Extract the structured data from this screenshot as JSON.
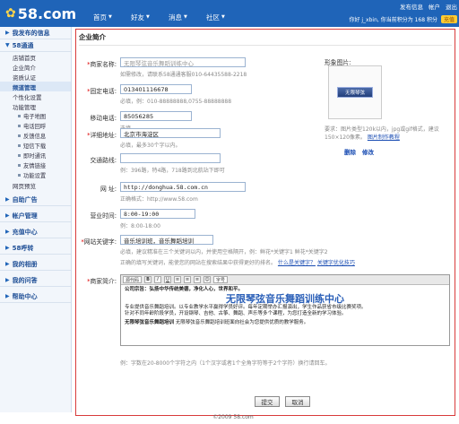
{
  "header": {
    "logo_text": "58.com",
    "nav": [
      "首页",
      "好友",
      "消息",
      "社区"
    ],
    "top_links": [
      "发布信息",
      "帐户",
      "退出"
    ],
    "user_line": "你好 j_xbin, 你当前积分为 168 积分",
    "recharge": "充值"
  },
  "sidebar": {
    "sections": [
      {
        "title": "我发布的信息"
      },
      {
        "title": "58通通",
        "items": [
          "店铺首页",
          "企业简介",
          "资质认证",
          "频道管理",
          "个性化设置",
          "功能管理"
        ]
      }
    ],
    "sub_items": [
      "电子地图",
      "电话回呼",
      "反馈信息",
      "短信下载",
      "即时通讯",
      "友情链接",
      "功能设置"
    ],
    "after_items": [
      "网页预览"
    ],
    "more_sections": [
      "自助广告",
      "帐户管理",
      "充值中心",
      "58呼转",
      "我的相册",
      "我的问答",
      "帮助中心"
    ],
    "active_item": "频道管理"
  },
  "main": {
    "title": "企业简介",
    "company_name": {
      "label": "商家名称:",
      "value": "无限琴弦音乐舞蹈训练中心",
      "hint": "如需修改，请联系58通通客服010-64435588-2218"
    },
    "fixed_phone": {
      "label": "固定电话:",
      "value": "013401116678",
      "hint": "必填，例：010-88888888,0755-88888888"
    },
    "mobile": {
      "label": "移动电话:",
      "value": "85056285",
      "hint": "选填"
    },
    "address": {
      "label": "详细地址:",
      "value": "北京市海淀区",
      "hint": "必填，最多30个字以内。"
    },
    "traffic": {
      "label": "交通路线:",
      "value": "",
      "hint": "例：396路，特4路，718路到北航站下即可"
    },
    "website": {
      "label": "网 址:",
      "value": "http://donghua.58.com.cn",
      "hint": "正确格式：http://www.58.com"
    },
    "hours": {
      "label": "营业时间:",
      "value": "8:00-19:00",
      "hint": "例：8:00-18:00"
    },
    "keywords": {
      "label": "网站关键字:",
      "value": "音乐培训班，音乐舞蹈培训",
      "hint1": "必填，建议精准在三个关键词以内，并使用空格隔开，例：鲜花*关键字1 鲜花*关键字2",
      "hint2": "正确的填写关键词，能使您的网站在搜索结果中获得更好的排名。",
      "link1": "什么是关键字？",
      "link2": "关键字优化技巧"
    },
    "intro": {
      "label": "商家简介:",
      "hint": "例：字数在20-8000个字符之内（1个汉字或者1个全角字符等于2个字符）换行请回车。"
    },
    "image": {
      "label": "形象图片:",
      "thumb_text": "无限琴弦",
      "hint": "要求：图片类型120k以内，jpg或gif格式，建议150×120像素。",
      "link": "图片制作教程",
      "delete": "删除",
      "modify": "修改"
    },
    "submit": "提交",
    "cancel": "取消"
  },
  "editor": {
    "toolbar": [
      "源代码",
      "B",
      "I",
      "U",
      "≡",
      "≡",
      "≡",
      "☺",
      "字号"
    ],
    "line1": "公司宗旨：弘扬中华传统美德，净化人心，世界和平。",
    "headline": "无限琴弦音乐舞蹈训练中心",
    "body1": "专业提供音乐舞蹈培训。以专业教学水平赢得学员好评。每年定期举办汇报演出，学生作品获省市级比赛奖项。",
    "body2": "针对不同年龄阶段学员，开设钢琴、吉他、古筝、舞蹈、声乐等多个课程，为您打造全新的学习体验。",
    "line2": "无限琴弦音乐舞蹈培训班面向社会为您提供优质的教学服务。",
    "headline2": "无限琴弦音乐舞蹈培训"
  },
  "footer": {
    "copyright": "©2009 58.com"
  }
}
